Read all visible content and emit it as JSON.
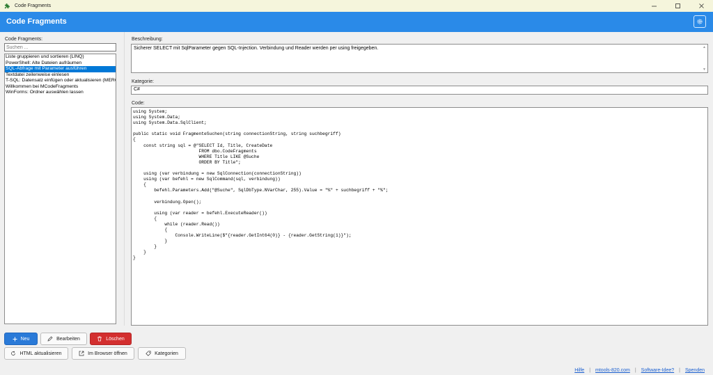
{
  "window": {
    "title": "Code Fragments",
    "controls": [
      "minimize-icon",
      "maximize-icon",
      "close-icon"
    ]
  },
  "header": {
    "title": "Code Fragments",
    "settings_icon": "gear-icon"
  },
  "sidebar": {
    "label": "Code Fragments:",
    "search_placeholder": "Suchen ...",
    "items": [
      {
        "label": "Liste gruppieren und sortieren (LINQ)",
        "selected": false
      },
      {
        "label": "PowerShell: Alte Dateien aufräumen",
        "selected": false
      },
      {
        "label": "SQL-Abfrage mit Parameter ausführen",
        "selected": true
      },
      {
        "label": "Textdatei zeilenweise einlesen",
        "selected": false
      },
      {
        "label": "T-SQL: Datensatz einfügen oder aktualisieren (MERGE)",
        "selected": false
      },
      {
        "label": "Willkommen bei MCodeFragments",
        "selected": false
      },
      {
        "label": "WinForms: Ordner auswählen lassen",
        "selected": false
      }
    ]
  },
  "form": {
    "description_label": "Beschreibung:",
    "description_value": "Sicherer SELECT mit SqlParameter gegen SQL-Injection. Verbindung und Reader werden per using freigegeben.",
    "category_label": "Kategorie:",
    "category_value": "C#",
    "code_label": "Code:",
    "code_value": "using System;\nusing System.Data;\nusing System.Data.SqlClient;\n\npublic static void FragmenteSuchen(string connectionString, string suchbegriff)\n{\n    const string sql = @\"SELECT Id, Title, CreateDate\n                         FROM dbo.CodeFragments\n                         WHERE Title LIKE @Suche\n                         ORDER BY Title\";\n\n    using (var verbindung = new SqlConnection(connectionString))\n    using (var befehl = new SqlCommand(sql, verbindung))\n    {\n        befehl.Parameters.Add(\"@Suche\", SqlDbType.NVarChar, 255).Value = \"%\" + suchbegriff + \"%\";\n\n        verbindung.Open();\n\n        using (var reader = befehl.ExecuteReader())\n        {\n            while (reader.Read())\n            {\n                Console.WriteLine($\"{reader.GetInt64(0)} - {reader.GetString(1)}\");\n            }\n        }\n    }\n}"
  },
  "toolbar": {
    "new_label": "Neu",
    "edit_label": "Bearbeiten",
    "delete_label": "Löschen",
    "html_refresh_label": "HTML aktualisieren",
    "browser_open_label": "Im Browser öffnen",
    "categories_label": "Kategorien"
  },
  "footer": {
    "help": "Hilfe",
    "site": "mtools-820.com",
    "idea": "Software-Idee?",
    "donate": "Spenden"
  },
  "colors": {
    "header_blue": "#2a8ae8",
    "selection_blue": "#0078d7",
    "primary_button": "#2a7ad8",
    "danger_button": "#d32f2f",
    "link": "#1a5fd0"
  }
}
